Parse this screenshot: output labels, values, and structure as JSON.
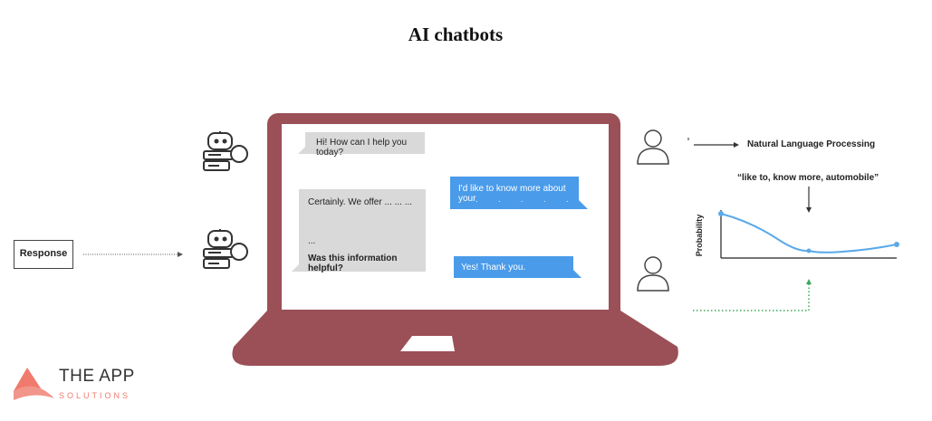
{
  "title": "AI chatbots",
  "chat": {
    "bot_greeting": "Hi! How can I help you today?",
    "user_message_1": "I'd like to know more about your",
    "user_message_1_dots": ". . . . .",
    "bot_reply_line1": "Certainly. We offer  ... ... ...",
    "bot_reply_line2": "...",
    "bot_reply_question": "Was this information helpful?",
    "user_message_2": "Yes! Thank you."
  },
  "pipeline": {
    "response_label": "Response",
    "nlp_label": "Natural Language Processing",
    "keywords_quote": "“like to, know more, automobile”",
    "graph_ylabel": "Probability"
  },
  "logo": {
    "name": "THE APP",
    "sub": "SOLUTIONS"
  },
  "colors": {
    "laptop": "#9b4f56",
    "user_bubble": "#4a9bea",
    "bot_bubble": "#d9d9d9",
    "curve": "#5aa9ea",
    "dotted_green": "#3aa85a",
    "logo_accent": "#f07a6c"
  },
  "icons": [
    "robot-icon",
    "user-icon",
    "arrow-right-icon",
    "arrow-down-icon",
    "arrow-up-icon"
  ]
}
